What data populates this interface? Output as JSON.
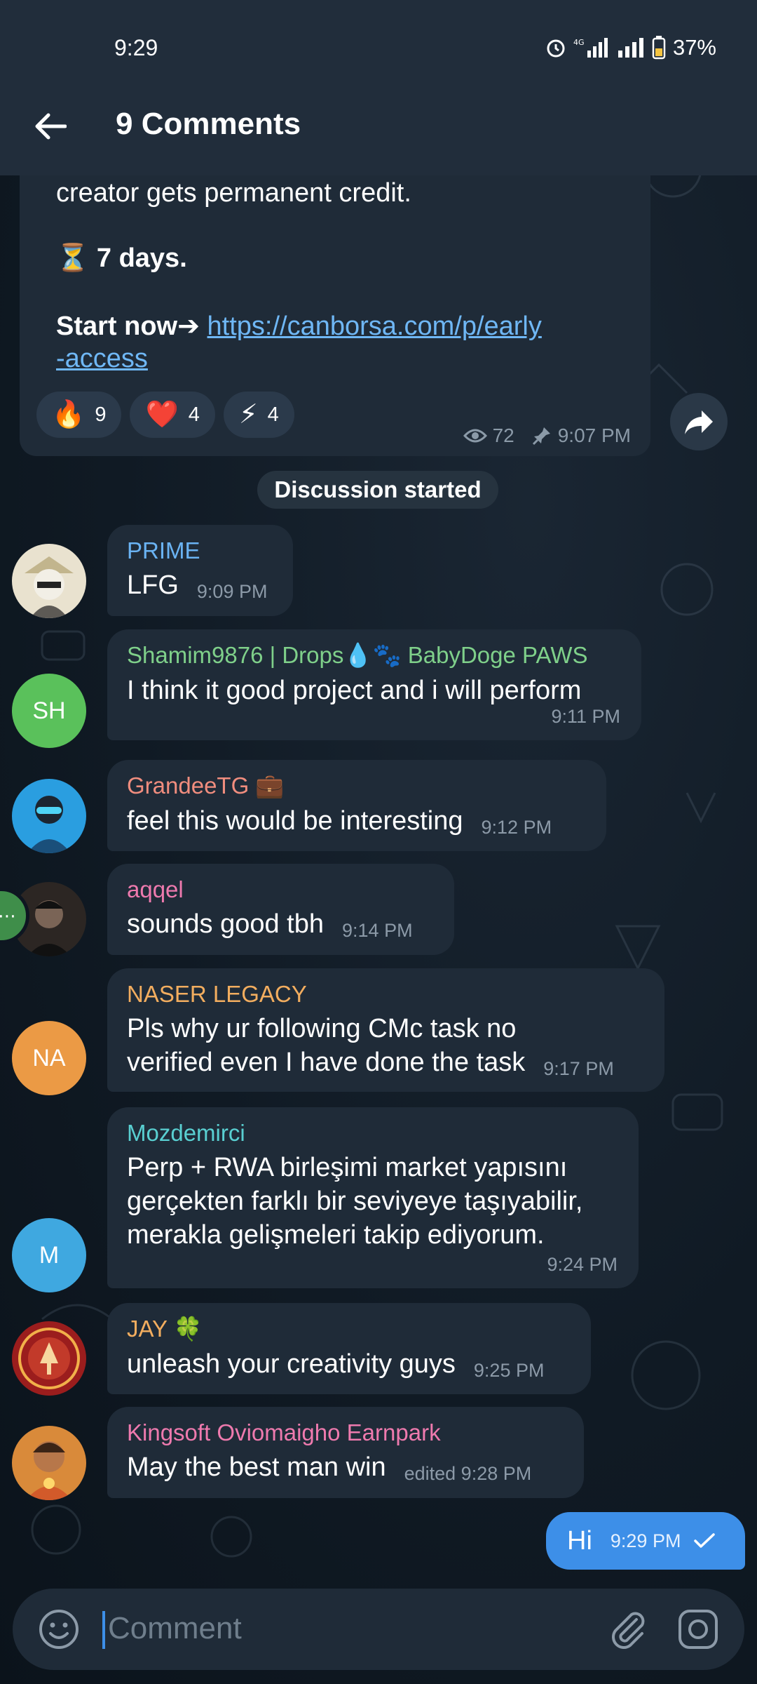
{
  "status_bar": {
    "time": "9:29",
    "battery": "37%"
  },
  "header": {
    "title": "9 Comments"
  },
  "post": {
    "line1": "creator gets permanent credit.",
    "line2_emoji": "⏳",
    "line2": "7 days.",
    "line3_prefix": "Start now➔",
    "link_line1": "https://canborsa.com/p/early",
    "link_line2": "-access",
    "reactions": [
      {
        "emoji": "🔥",
        "count": "9"
      },
      {
        "emoji": "❤️",
        "count": "4"
      },
      {
        "emoji": "⚡",
        "count": "4"
      }
    ],
    "views": "72",
    "time": "9:07 PM"
  },
  "service_message": "Discussion started",
  "comments": [
    {
      "name": "PRIME",
      "text": "LFG",
      "time": "9:09 PM",
      "name_color": "#6ab3f3"
    },
    {
      "name": "Shamim9876 | Drops💧🐾 BabyDoge PAWS",
      "text": "I think it good project and i will perform",
      "time": "9:11 PM",
      "initials": "SH",
      "name_color": "#7fd08a",
      "avatar_color": "#5ac15b"
    },
    {
      "name": "GrandeeTG 💼",
      "text": "feel this would be interesting",
      "time": "9:12 PM",
      "name_color": "#f08d7e"
    },
    {
      "name": "aqqel",
      "text": "sounds good tbh",
      "time": "9:14 PM",
      "name_color": "#ee7aae"
    },
    {
      "name": "NASER LEGACY",
      "text_line1": "Pls why ur following CMc task no",
      "text_line2": "verified even I have done the task",
      "time": "9:17 PM",
      "initials": "NA",
      "name_color": "#f2ad5f",
      "avatar_color": "#eb9a45"
    },
    {
      "name": "Mozdemirci",
      "text_line1": "Perp + RWA birleşimi market yapısını",
      "text_line2": "gerçekten farklı bir seviyeye taşıyabilir,",
      "text_line3": "merakla gelişmeleri takip ediyorum.",
      "time": "9:24 PM",
      "initials": "M",
      "name_color": "#59cfd1",
      "avatar_color": "#3fa8e0"
    },
    {
      "name": "JAY 🍀",
      "text": "unleash your creativity guys",
      "time": "9:25 PM",
      "name_color": "#f2ad5f"
    },
    {
      "name": "Kingsoft Oviomaigho Earnpark",
      "text": "May the best man win",
      "time": "edited 9:28 PM",
      "name_color": "#ee7aae"
    }
  ],
  "outgoing": {
    "text": "Hi",
    "time": "9:29 PM"
  },
  "composer": {
    "placeholder": "Comment"
  }
}
